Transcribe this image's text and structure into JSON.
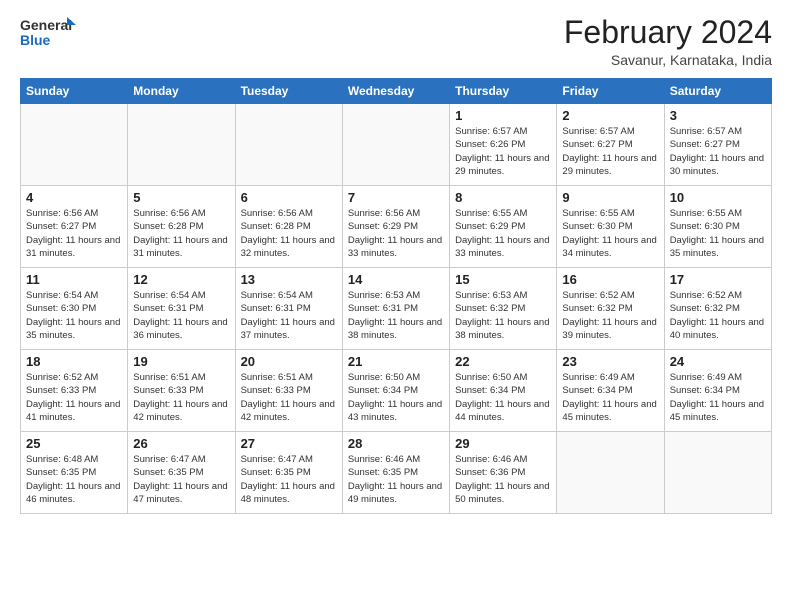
{
  "logo": {
    "general": "General",
    "blue": "Blue"
  },
  "title": "February 2024",
  "location": "Savanur, Karnataka, India",
  "days_of_week": [
    "Sunday",
    "Monday",
    "Tuesday",
    "Wednesday",
    "Thursday",
    "Friday",
    "Saturday"
  ],
  "weeks": [
    [
      {
        "day": "",
        "info": ""
      },
      {
        "day": "",
        "info": ""
      },
      {
        "day": "",
        "info": ""
      },
      {
        "day": "",
        "info": ""
      },
      {
        "day": "1",
        "info": "Sunrise: 6:57 AM\nSunset: 6:26 PM\nDaylight: 11 hours and 29 minutes."
      },
      {
        "day": "2",
        "info": "Sunrise: 6:57 AM\nSunset: 6:27 PM\nDaylight: 11 hours and 29 minutes."
      },
      {
        "day": "3",
        "info": "Sunrise: 6:57 AM\nSunset: 6:27 PM\nDaylight: 11 hours and 30 minutes."
      }
    ],
    [
      {
        "day": "4",
        "info": "Sunrise: 6:56 AM\nSunset: 6:27 PM\nDaylight: 11 hours and 31 minutes."
      },
      {
        "day": "5",
        "info": "Sunrise: 6:56 AM\nSunset: 6:28 PM\nDaylight: 11 hours and 31 minutes."
      },
      {
        "day": "6",
        "info": "Sunrise: 6:56 AM\nSunset: 6:28 PM\nDaylight: 11 hours and 32 minutes."
      },
      {
        "day": "7",
        "info": "Sunrise: 6:56 AM\nSunset: 6:29 PM\nDaylight: 11 hours and 33 minutes."
      },
      {
        "day": "8",
        "info": "Sunrise: 6:55 AM\nSunset: 6:29 PM\nDaylight: 11 hours and 33 minutes."
      },
      {
        "day": "9",
        "info": "Sunrise: 6:55 AM\nSunset: 6:30 PM\nDaylight: 11 hours and 34 minutes."
      },
      {
        "day": "10",
        "info": "Sunrise: 6:55 AM\nSunset: 6:30 PM\nDaylight: 11 hours and 35 minutes."
      }
    ],
    [
      {
        "day": "11",
        "info": "Sunrise: 6:54 AM\nSunset: 6:30 PM\nDaylight: 11 hours and 35 minutes."
      },
      {
        "day": "12",
        "info": "Sunrise: 6:54 AM\nSunset: 6:31 PM\nDaylight: 11 hours and 36 minutes."
      },
      {
        "day": "13",
        "info": "Sunrise: 6:54 AM\nSunset: 6:31 PM\nDaylight: 11 hours and 37 minutes."
      },
      {
        "day": "14",
        "info": "Sunrise: 6:53 AM\nSunset: 6:31 PM\nDaylight: 11 hours and 38 minutes."
      },
      {
        "day": "15",
        "info": "Sunrise: 6:53 AM\nSunset: 6:32 PM\nDaylight: 11 hours and 38 minutes."
      },
      {
        "day": "16",
        "info": "Sunrise: 6:52 AM\nSunset: 6:32 PM\nDaylight: 11 hours and 39 minutes."
      },
      {
        "day": "17",
        "info": "Sunrise: 6:52 AM\nSunset: 6:32 PM\nDaylight: 11 hours and 40 minutes."
      }
    ],
    [
      {
        "day": "18",
        "info": "Sunrise: 6:52 AM\nSunset: 6:33 PM\nDaylight: 11 hours and 41 minutes."
      },
      {
        "day": "19",
        "info": "Sunrise: 6:51 AM\nSunset: 6:33 PM\nDaylight: 11 hours and 42 minutes."
      },
      {
        "day": "20",
        "info": "Sunrise: 6:51 AM\nSunset: 6:33 PM\nDaylight: 11 hours and 42 minutes."
      },
      {
        "day": "21",
        "info": "Sunrise: 6:50 AM\nSunset: 6:34 PM\nDaylight: 11 hours and 43 minutes."
      },
      {
        "day": "22",
        "info": "Sunrise: 6:50 AM\nSunset: 6:34 PM\nDaylight: 11 hours and 44 minutes."
      },
      {
        "day": "23",
        "info": "Sunrise: 6:49 AM\nSunset: 6:34 PM\nDaylight: 11 hours and 45 minutes."
      },
      {
        "day": "24",
        "info": "Sunrise: 6:49 AM\nSunset: 6:34 PM\nDaylight: 11 hours and 45 minutes."
      }
    ],
    [
      {
        "day": "25",
        "info": "Sunrise: 6:48 AM\nSunset: 6:35 PM\nDaylight: 11 hours and 46 minutes."
      },
      {
        "day": "26",
        "info": "Sunrise: 6:47 AM\nSunset: 6:35 PM\nDaylight: 11 hours and 47 minutes."
      },
      {
        "day": "27",
        "info": "Sunrise: 6:47 AM\nSunset: 6:35 PM\nDaylight: 11 hours and 48 minutes."
      },
      {
        "day": "28",
        "info": "Sunrise: 6:46 AM\nSunset: 6:35 PM\nDaylight: 11 hours and 49 minutes."
      },
      {
        "day": "29",
        "info": "Sunrise: 6:46 AM\nSunset: 6:36 PM\nDaylight: 11 hours and 50 minutes."
      },
      {
        "day": "",
        "info": ""
      },
      {
        "day": "",
        "info": ""
      }
    ]
  ]
}
